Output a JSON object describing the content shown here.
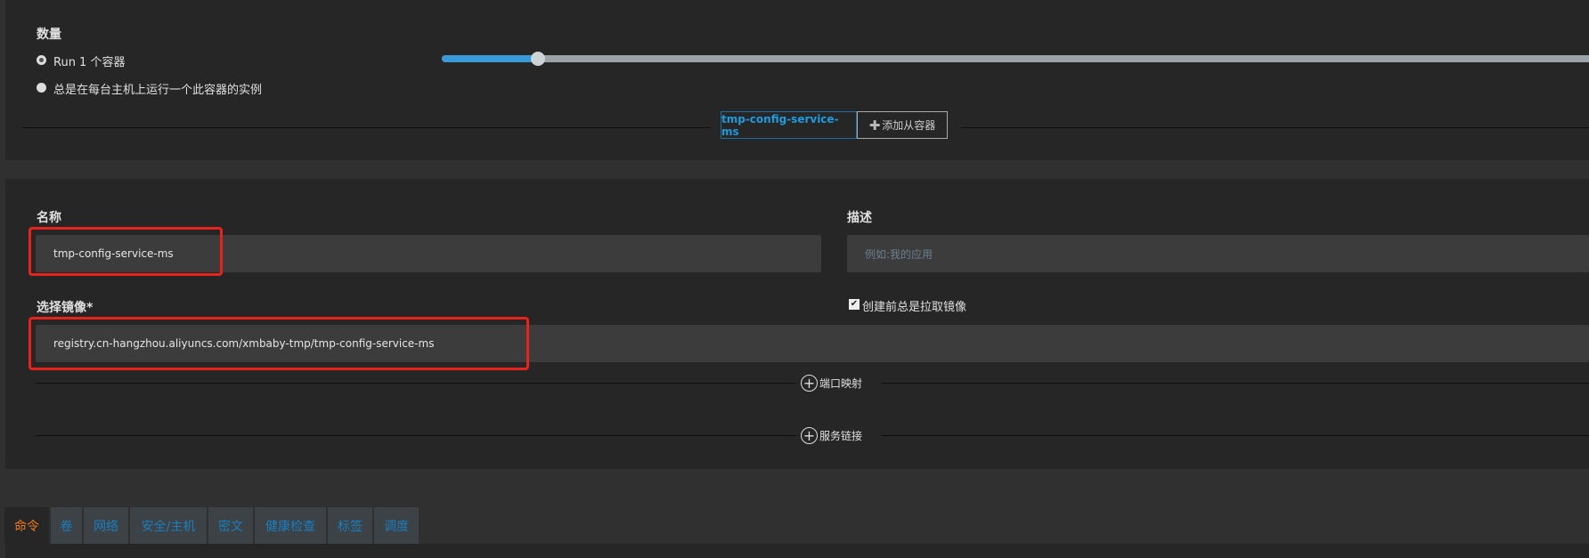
{
  "scale": {
    "label": "数量",
    "options": [
      {
        "label": "Run 1 个容器",
        "selected": true
      },
      {
        "label": "总是在每台主机上运行一个此容器的实例",
        "selected": false
      }
    ],
    "slider_value": 1,
    "slider_fraction": 0.084
  },
  "containers": {
    "primary": "tmp-config-service-ms",
    "add_sidekick": "添加从容器"
  },
  "form": {
    "name_label": "名称",
    "name_value": "tmp-config-service-ms",
    "desc_label": "描述",
    "desc_placeholder": "例如:我的应用",
    "image_label": "选择镜像*",
    "image_value": "registry.cn-hangzhou.aliyuncs.com/xmbaby-tmp/tmp-config-service-ms",
    "pull_checkbox_label": "创建前总是拉取镜像",
    "pull_checked": true,
    "port_mapping": "端口映射",
    "service_links": "服务链接"
  },
  "tabs": [
    "命令",
    "卷",
    "网络",
    "安全/主机",
    "密文",
    "健康检查",
    "标签",
    "调度"
  ],
  "colors": {
    "accent": "#1a7fc1",
    "active_tab": "#f07b1e",
    "highlight": "#e8231b"
  }
}
